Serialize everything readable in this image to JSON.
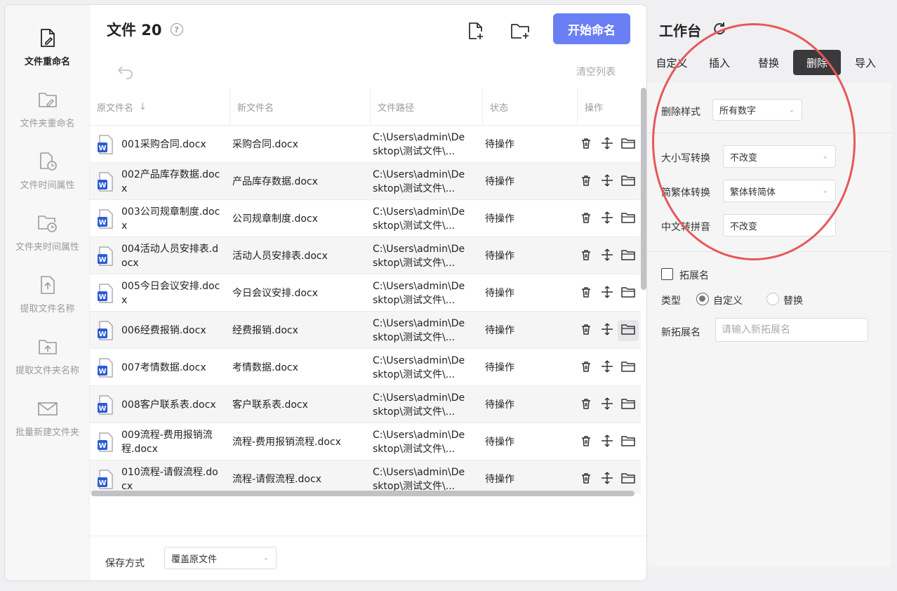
{
  "sidebar": {
    "items": [
      {
        "label": "文件重命名",
        "icon": "file-edit-icon",
        "active": true
      },
      {
        "label": "文件夹重命名",
        "icon": "folder-edit-icon",
        "active": false
      },
      {
        "label": "文件时间属性",
        "icon": "file-clock-icon",
        "active": false
      },
      {
        "label": "文件夹时间属性",
        "icon": "folder-clock-icon",
        "active": false
      },
      {
        "label": "提取文件名称",
        "icon": "file-export-icon",
        "active": false
      },
      {
        "label": "提取文件夹名称",
        "icon": "folder-export-icon",
        "active": false
      },
      {
        "label": "批量新建文件夹",
        "icon": "mail-folder-icon",
        "active": false
      }
    ]
  },
  "header": {
    "title": "文件 20",
    "start_button": "开始命名",
    "clear_list": "清空列表"
  },
  "table": {
    "columns": [
      "原文件名",
      "新文件名",
      "文件路径",
      "状态",
      "操作"
    ],
    "rows": [
      {
        "original": "001采购合同.docx",
        "new": "采购合同.docx",
        "path": "C:\\Users\\admin\\Desktop\\测试文件\\...",
        "status": "待操作"
      },
      {
        "original": "002产品库存数据.docx",
        "new": "产品库存数据.docx",
        "path": "C:\\Users\\admin\\Desktop\\测试文件\\...",
        "status": "待操作"
      },
      {
        "original": "003公司规章制度.docx",
        "new": "公司规章制度.docx",
        "path": "C:\\Users\\admin\\Desktop\\测试文件\\...",
        "status": "待操作"
      },
      {
        "original": "004活动人员安排表.docx",
        "new": "活动人员安排表.docx",
        "path": "C:\\Users\\admin\\Desktop\\测试文件\\...",
        "status": "待操作"
      },
      {
        "original": "005今日会议安排.docx",
        "new": "今日会议安排.docx",
        "path": "C:\\Users\\admin\\Desktop\\测试文件\\...",
        "status": "待操作"
      },
      {
        "original": "006经费报销.docx",
        "new": "经费报销.docx",
        "path": "C:\\Users\\admin\\Desktop\\测试文件\\...",
        "status": "待操作"
      },
      {
        "original": "007考情数据.docx",
        "new": "考情数据.docx",
        "path": "C:\\Users\\admin\\Desktop\\测试文件\\...",
        "status": "待操作"
      },
      {
        "original": "008客户联系表.docx",
        "new": "客户联系表.docx",
        "path": "C:\\Users\\admin\\Desktop\\测试文件\\...",
        "status": "待操作"
      },
      {
        "original": "009流程-费用报销流程.docx",
        "new": "流程-费用报销流程.docx",
        "path": "C:\\Users\\admin\\Desktop\\测试文件\\...",
        "status": "待操作"
      },
      {
        "original": "010流程-请假流程.docx",
        "new": "流程-请假流程.docx",
        "path": "C:\\Users\\admin\\Desktop\\测试文件\\...",
        "status": "待操作"
      }
    ]
  },
  "footer": {
    "save_label": "保存方式",
    "save_value": "覆盖原文件"
  },
  "workbench": {
    "title": "工作台",
    "tabs": [
      "自定义",
      "插入",
      "替换",
      "删除",
      "导入"
    ],
    "active_tab": "删除",
    "delete_style_label": "删除样式",
    "delete_style_value": "所有数字",
    "case_label": "大小写转换",
    "case_value": "不改变",
    "trad_label": "简繁体转换",
    "trad_value": "繁体转简体",
    "pinyin_label": "中文转拼音",
    "pinyin_value": "不改变",
    "ext_checkbox_label": "拓展名",
    "type_label": "类型",
    "type_options": [
      "自定义",
      "替换"
    ],
    "new_ext_label": "新拓展名",
    "new_ext_placeholder": "请输入新拓展名"
  },
  "colors": {
    "accent": "#6b7ff5",
    "active_tab": "#3a3a3c",
    "annotation": "#e85757",
    "word_blue": "#2b5cd6"
  }
}
